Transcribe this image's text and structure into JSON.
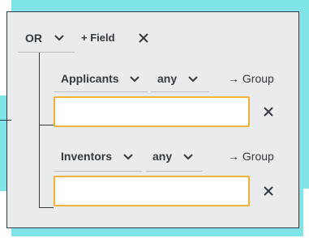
{
  "colors": {
    "accent": "#7fe5e8",
    "input_border": "#f2b13b",
    "panel_bg": "#e9ebed",
    "text": "#333a40"
  },
  "header": {
    "operator": "OR",
    "add_field_label": "+ Field"
  },
  "rows": [
    {
      "field": "Applicants",
      "match": "any",
      "group_label": "→ Group",
      "value": "",
      "placeholder": ""
    },
    {
      "field": "Inventors",
      "match": "any",
      "group_label": "→ Group",
      "value": "",
      "placeholder": ""
    }
  ]
}
